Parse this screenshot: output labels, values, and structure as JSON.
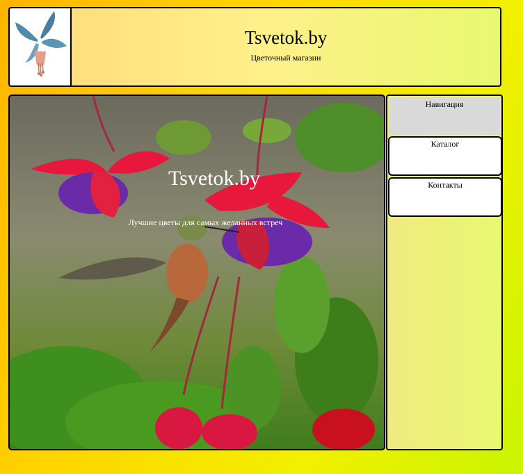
{
  "header": {
    "title": "Tsvetok.by",
    "subtitle": "Цветочный магазин",
    "logo_icon": "flower-logo-icon"
  },
  "hero": {
    "title": "Tsvetok.by",
    "subtitle": "Лучшие цветы для самых желанных встреч",
    "image": "hummingbird-fuchsia-photo"
  },
  "sidebar": {
    "heading": "Навигация",
    "items": [
      {
        "label": "Каталог"
      },
      {
        "label": "Контакты"
      }
    ]
  }
}
